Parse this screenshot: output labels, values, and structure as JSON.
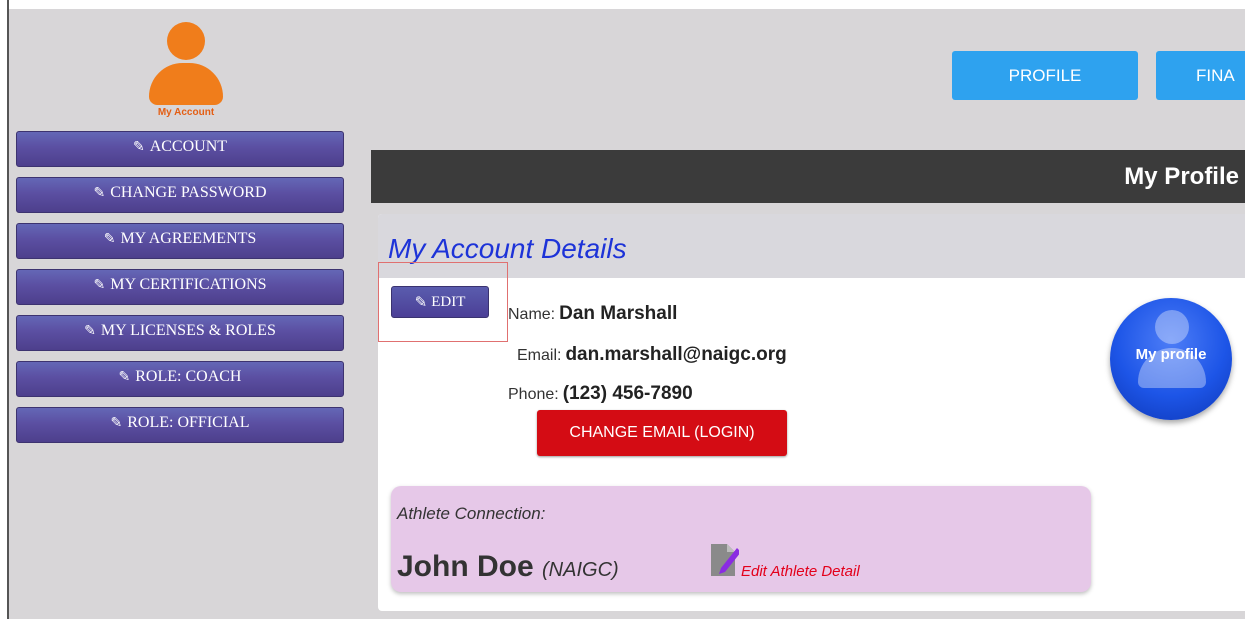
{
  "sidebar": {
    "logo_label": "My Account",
    "items": [
      {
        "label": "ACCOUNT",
        "icon": "pencil-icon"
      },
      {
        "label": "CHANGE PASSWORD",
        "icon": "pencil-icon"
      },
      {
        "label": "MY AGREEMENTS",
        "icon": "pencil-icon"
      },
      {
        "label": "MY CERTIFICATIONS",
        "icon": "pencil-icon"
      },
      {
        "label": "MY LICENSES & ROLES",
        "icon": "pencil-icon"
      },
      {
        "label": "ROLE: COACH",
        "icon": "pencil-icon"
      },
      {
        "label": "ROLE: OFFICIAL",
        "icon": "pencil-icon"
      }
    ]
  },
  "nav": {
    "profile_label": "PROFILE",
    "second_label": "FINA"
  },
  "header": {
    "title": "My Profile"
  },
  "details": {
    "title": "My Account Details",
    "edit_label": "EDIT",
    "name_label": "Name:",
    "name_value": "Dan Marshall",
    "email_label": "Email:",
    "email_value": "dan.marshall@naigc.org",
    "phone_label": "Phone:",
    "phone_value": "(123) 456-7890",
    "change_email_label": "CHANGE EMAIL (LOGIN)",
    "badge_label": "My profile"
  },
  "athlete": {
    "label": "Athlete Connection:",
    "name": "John Doe",
    "org": "(NAIGC)",
    "edit_link": "Edit Athlete Detail"
  },
  "colors": {
    "sidebar_button": "#5b4fa2",
    "nav_button": "#2ea2ef",
    "change_email_button": "#d40c14",
    "title_text": "#1d33d8",
    "athlete_box": "#e6c8e8"
  }
}
